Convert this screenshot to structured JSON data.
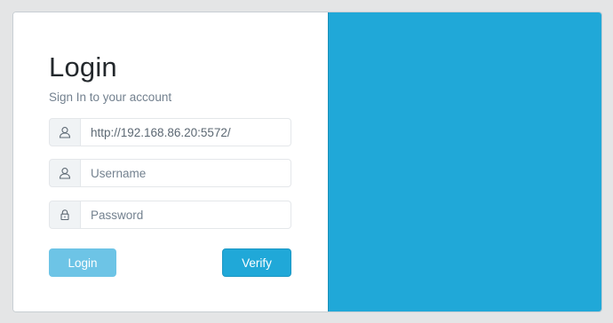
{
  "login": {
    "title": "Login",
    "subtitle": "Sign In to your account",
    "server_field": {
      "value": "http://192.168.86.20:5572/",
      "icon": "user-icon"
    },
    "username_field": {
      "placeholder": "Username",
      "icon": "user-icon"
    },
    "password_field": {
      "placeholder": "Password",
      "icon": "lock-icon"
    },
    "login_label": "Login",
    "verify_label": "Verify"
  },
  "colors": {
    "accent": "#20a8d8",
    "accent_disabled": "#6dc4e6",
    "background": "#e4e5e6"
  }
}
